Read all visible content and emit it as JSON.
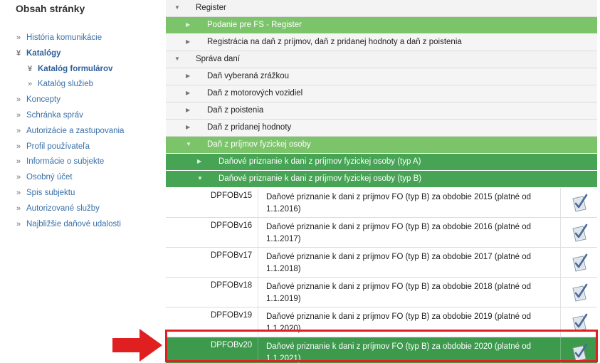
{
  "sidebar": {
    "title": "Obsah stránky",
    "items": [
      {
        "label": "História komunikácie",
        "bullet": "»",
        "level": 0,
        "active": false
      },
      {
        "label": "Katalógy",
        "bullet": "¥",
        "level": 0,
        "active": true
      },
      {
        "label": "Katalóg formulárov",
        "bullet": "¥",
        "level": 1,
        "active": true
      },
      {
        "label": "Katalóg služieb",
        "bullet": "»",
        "level": 1,
        "active": false
      },
      {
        "label": "Koncepty",
        "bullet": "»",
        "level": 0,
        "active": false
      },
      {
        "label": "Schránka správ",
        "bullet": "»",
        "level": 0,
        "active": false
      },
      {
        "label": "Autorizácie a zastupovania",
        "bullet": "»",
        "level": 0,
        "active": false
      },
      {
        "label": "Profil používateľa",
        "bullet": "»",
        "level": 0,
        "active": false
      },
      {
        "label": "Informácie o subjekte",
        "bullet": "»",
        "level": 0,
        "active": false
      },
      {
        "label": "Osobný účet",
        "bullet": "»",
        "level": 0,
        "active": false
      },
      {
        "label": "Spis subjektu",
        "bullet": "»",
        "level": 0,
        "active": false
      },
      {
        "label": "Autorizované služby",
        "bullet": "»",
        "level": 0,
        "active": false
      },
      {
        "label": "Najbližšie daňové udalosti",
        "bullet": "»",
        "level": 0,
        "active": false
      }
    ]
  },
  "tree": {
    "rows": [
      {
        "label": "Register",
        "level": 0,
        "expanded": true,
        "style": "l0",
        "arrow": "▼"
      },
      {
        "label": "Podanie pre FS - Register",
        "level": 1,
        "expanded": false,
        "style": "hl",
        "arrow": "▶"
      },
      {
        "label": "Registrácia na daň z príjmov, daň z pridanej hodnoty a daň z poistenia",
        "level": 1,
        "expanded": false,
        "style": "l1",
        "arrow": "▶"
      },
      {
        "label": "Správa daní",
        "level": 0,
        "expanded": true,
        "style": "l0",
        "arrow": "▼"
      },
      {
        "label": "Daň vyberaná zrážkou",
        "level": 1,
        "expanded": false,
        "style": "l1",
        "arrow": "▶"
      },
      {
        "label": "Daň z motorových vozidiel",
        "level": 1,
        "expanded": false,
        "style": "l1",
        "arrow": "▶"
      },
      {
        "label": "Daň z poistenia",
        "level": 1,
        "expanded": false,
        "style": "l1",
        "arrow": "▶"
      },
      {
        "label": "Daň z pridanej hodnoty",
        "level": 1,
        "expanded": false,
        "style": "l1",
        "arrow": "▶"
      },
      {
        "label": "Daň z príjmov fyzickej osoby",
        "level": 1,
        "expanded": true,
        "style": "hl",
        "arrow": "▼"
      },
      {
        "label": "Daňové priznanie k dani z príjmov fyzickej osoby (typ A)",
        "level": 2,
        "expanded": false,
        "style": "hl2",
        "arrow": "▶"
      },
      {
        "label": "Daňové priznanie k dani z príjmov fyzickej osoby (typ B)",
        "level": 2,
        "expanded": true,
        "style": "hl2",
        "arrow": "▼"
      }
    ],
    "forms": [
      {
        "code": "DPFOBv15",
        "description": "Daňové priznanie k dani z príjmov FO (typ B) za obdobie 2015 (platné od 1.1.2016)",
        "selected": false
      },
      {
        "code": "DPFOBv16",
        "description": "Daňové priznanie k dani z príjmov FO (typ B) za obdobie 2016 (platné od 1.1.2017)",
        "selected": false
      },
      {
        "code": "DPFOBv17",
        "description": "Daňové priznanie k dani z príjmov FO (typ B) za obdobie 2017 (platné od 1.1.2018)",
        "selected": false
      },
      {
        "code": "DPFOBv18",
        "description": "Daňové priznanie k dani z príjmov FO (typ B) za obdobie 2018 (platné od 1.1.2019)",
        "selected": false
      },
      {
        "code": "DPFOBv19",
        "description": "Daňové priznanie k dani z príjmov FO (typ B) za obdobie 2019 (platné od 1.1.2020)",
        "selected": false
      },
      {
        "code": "DPFOBv20",
        "description": "Daňové priznanie k dani z príjmov FO (typ B) za obdobie 2020 (platné od 1.1.2021)",
        "selected": true
      }
    ],
    "action_icon": "form-check-icon"
  },
  "colors": {
    "link": "#3a70a8",
    "highlight_light": "#7cc46a",
    "highlight_dark": "#47a454",
    "selected_row": "#3d9a4d",
    "annotation": "#e02020"
  }
}
